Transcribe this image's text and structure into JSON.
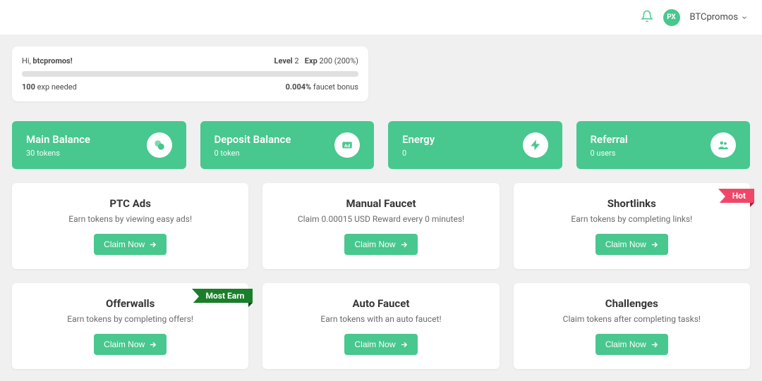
{
  "header": {
    "avatar_text": "PX",
    "username": "BTCpromos"
  },
  "exp": {
    "greeting_prefix": "Hi, ",
    "greeting_user": "btcpromos!",
    "level_label": "Level ",
    "level_value": "2",
    "exp_label": "Exp ",
    "exp_value": "200 (200%)",
    "needed_value": "100",
    "needed_label": " exp needed",
    "bonus_value": "0.004%",
    "bonus_label": " faucet bonus"
  },
  "stats": {
    "main_balance": {
      "title": "Main Balance",
      "value": "30 tokens"
    },
    "deposit_balance": {
      "title": "Deposit Balance",
      "value": "0 token"
    },
    "energy": {
      "title": "Energy",
      "value": "0"
    },
    "referral": {
      "title": "Referral",
      "value": "0 users"
    }
  },
  "cards": {
    "ptc": {
      "title": "PTC Ads",
      "desc": "Earn tokens by viewing easy ads!",
      "button": "Claim Now"
    },
    "faucet": {
      "title": "Manual Faucet",
      "desc": "Claim 0.00015 USD Reward every 0 minutes!",
      "button": "Claim Now"
    },
    "shortlinks": {
      "title": "Shortlinks",
      "desc": "Earn tokens by completing links!",
      "button": "Claim Now",
      "ribbon": "Hot"
    },
    "offerwalls": {
      "title": "Offerwalls",
      "desc": "Earn tokens by completing offers!",
      "button": "Claim Now",
      "ribbon": "Most Earn"
    },
    "autofaucet": {
      "title": "Auto Faucet",
      "desc": "Earn tokens with an auto faucet!",
      "button": "Claim Now"
    },
    "challenges": {
      "title": "Challenges",
      "desc": "Claim tokens after completing tasks!",
      "button": "Claim Now"
    }
  }
}
